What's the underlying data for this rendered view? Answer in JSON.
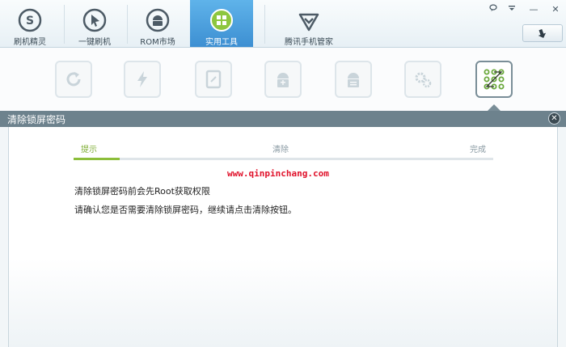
{
  "nav": {
    "items": [
      {
        "label": "刷机精灵",
        "icon": "shield-s-icon"
      },
      {
        "label": "一键刷机",
        "icon": "cursor-icon"
      },
      {
        "label": "ROM市场",
        "icon": "android-icon"
      },
      {
        "label": "实用工具",
        "icon": "grid-icon",
        "active": true
      },
      {
        "label": "腾讯手机管家",
        "icon": "shield-check-icon"
      }
    ]
  },
  "window": {
    "feedback_icon": "speech-bubble-icon",
    "menu_icon": "menu-icon",
    "minimize_label": "—",
    "close_label": "✕",
    "back_icon": "arrow-down-return-icon"
  },
  "tools": [
    {
      "icon": "refresh-icon"
    },
    {
      "icon": "lightning-icon"
    },
    {
      "icon": "tablet-icon"
    },
    {
      "icon": "android-box-icon"
    },
    {
      "icon": "android-box-alt-icon"
    },
    {
      "icon": "gears-icon"
    },
    {
      "icon": "pattern-lock-icon",
      "active": true
    }
  ],
  "dialog": {
    "title": "清除锁屏密码",
    "close_label": "✕",
    "steps": [
      {
        "label": "提示",
        "active": true
      },
      {
        "label": "清除",
        "active": false
      },
      {
        "label": "完成",
        "active": false
      }
    ],
    "progress": 0.11,
    "watermark": "www.qinpinchang.com",
    "line1": "清除锁屏密码前会先Root获取权限",
    "line2": "请确认您是否需要清除锁屏密码，继续请点击清除按钮。"
  },
  "colors": {
    "accent": "#3d8fd2",
    "progress": "#8cbe3a",
    "step_active": "#7fae34",
    "header": "#6d828d",
    "watermark": "#e0112a"
  }
}
